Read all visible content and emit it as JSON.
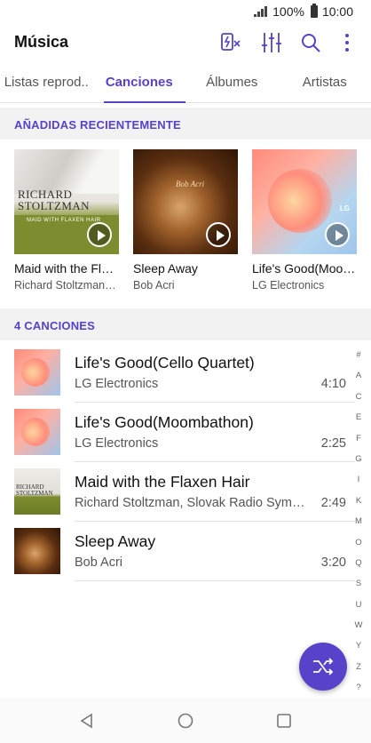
{
  "status_bar": {
    "battery": "100%",
    "time": "10:00"
  },
  "app": {
    "title": "Música"
  },
  "tabs": [
    {
      "label": "Listas reprod.."
    },
    {
      "label": "Canciones"
    },
    {
      "label": "Álbumes"
    },
    {
      "label": "Artistas"
    }
  ],
  "recent": {
    "header": "AÑADIDAS RECIENTEMENTE",
    "items": [
      {
        "title": "Maid with the Flaxen Hair",
        "artist": "Richard Stoltzman, Slovak Radio Symphony Orchestra",
        "art": "RICHARD STOLTZMAN",
        "art_sub": "MAID WITH FLAXEN HAIR"
      },
      {
        "title": "Sleep Away",
        "artist": "Bob Acri",
        "art": "Bob Acri"
      },
      {
        "title": "Life's Good(Moombathon)",
        "artist": "LG Electronics",
        "art": "LG"
      }
    ]
  },
  "songs": {
    "header": "4 CANCIONES",
    "items": [
      {
        "title": "Life's Good(Cello Quartet)",
        "artist": "LG Electronics",
        "duration": "4:10"
      },
      {
        "title": "Life's Good(Moombathon)",
        "artist": "LG Electronics",
        "duration": "2:25"
      },
      {
        "title": "Maid with the Flaxen Hair",
        "artist": "Richard Stoltzman, Slovak Radio Symphony Orchestra",
        "duration": "2:49",
        "art": "RICHARD STOLTZMAN"
      },
      {
        "title": "Sleep Away",
        "artist": "Bob Acri",
        "duration": "3:20"
      }
    ]
  },
  "alphabet_index": [
    "#",
    "A",
    "C",
    "E",
    "F",
    "G",
    "I",
    "K",
    "M",
    "O",
    "Q",
    "S",
    "U",
    "W",
    "Y",
    "Z",
    "?"
  ],
  "colors": {
    "accent": "#5842c9",
    "section_bg": "#f2f2f2"
  }
}
